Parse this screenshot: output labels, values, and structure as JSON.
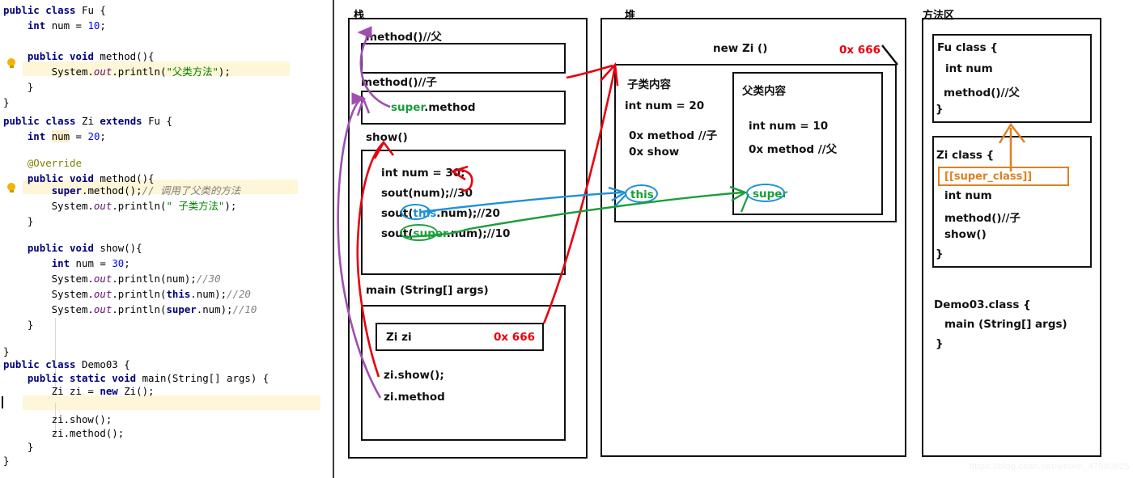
{
  "editor": {
    "lines": [
      {
        "t": "public class Fu {"
      },
      {
        "t": "    int num = 10;"
      },
      {
        "t": ""
      },
      {
        "t": "    public void method(){"
      },
      {
        "t": "        System.out.println(\"父类方法\");"
      },
      {
        "t": "    }"
      },
      {
        "t": "}"
      },
      {
        "t": ""
      },
      {
        "t": "public class Zi extends Fu {"
      },
      {
        "t": "    int num = 20;"
      },
      {
        "t": ""
      },
      {
        "t": "    @Override"
      },
      {
        "t": "    public void method(){"
      },
      {
        "t": "        super.method();// 调用了父类的方法"
      },
      {
        "t": "        System.out.println(\" 子类方法\");"
      },
      {
        "t": "    }"
      },
      {
        "t": ""
      },
      {
        "t": "    public void show(){"
      },
      {
        "t": "        int num = 30;"
      },
      {
        "t": "        System.out.println(num);//30"
      },
      {
        "t": "        System.out.println(this.num);//20"
      },
      {
        "t": "        System.out.println(super.num);//10"
      },
      {
        "t": "    }"
      },
      {
        "t": ""
      },
      {
        "t": "}"
      },
      {
        "t": "public class Demo03 {"
      },
      {
        "t": "    public static void main(String[] args) {"
      },
      {
        "t": "        Zi zi = new Zi();"
      },
      {
        "t": ""
      },
      {
        "t": "        zi.show();"
      },
      {
        "t": "        zi.method();"
      },
      {
        "t": "    }"
      },
      {
        "t": "}"
      }
    ]
  },
  "stack": {
    "zone_label": "栈",
    "frames": [
      {
        "title": "method()//父",
        "body": []
      },
      {
        "title": "method()//子",
        "body": [
          "super.method"
        ]
      },
      {
        "title": "show()",
        "body": [
          "int num = 30;",
          "sout(num);//30",
          "sout(this.num);//20",
          "sout(super.num);//10"
        ]
      },
      {
        "title": "main (String[] args)",
        "body": [
          "zi.show();",
          "zi.method"
        ]
      }
    ],
    "super_method_prefix": "super",
    "super_method_suffix": ".method",
    "show_lines": {
      "l1": "int num = 30;",
      "l2": "sout(num);//30",
      "l3_a": "sout(",
      "l3_this": "this",
      "l3_b": ".num);//20",
      "l4_a": "sout(",
      "l4_super": "super",
      "l4_b": ".num);//10"
    },
    "ref_var": "Zi zi",
    "ref_addr": "0x 666",
    "main_calls": [
      "zi.show();",
      "zi.method"
    ]
  },
  "heap": {
    "zone_label": "堆",
    "object_title": "new Zi ()",
    "object_addr": "0x 666",
    "child": {
      "title": "子类内容",
      "fields": [
        "int num = 20",
        "0x method //子",
        "0x show"
      ],
      "ref_label": "this"
    },
    "parent": {
      "title": "父类内容",
      "fields": [
        "int num = 10",
        "0x method //父"
      ],
      "ref_label": "super"
    }
  },
  "method_area": {
    "zone_label": "方法区",
    "fu_class": {
      "header": "Fu class {",
      "members": [
        "int num",
        "method()//父"
      ],
      "close": "}"
    },
    "zi_class": {
      "header": "Zi class {",
      "super_class_tag": "[[super_class]]",
      "members": [
        "int num",
        "method()//子",
        "show()"
      ],
      "close": "}"
    },
    "demo_class": {
      "header": "Demo03.class {",
      "members": [
        "main (String[] args)"
      ],
      "close": "}"
    }
  },
  "watermark": "https://blog.csdn.net/weixin_47980825",
  "colors": {
    "address_red": "#e8000d",
    "super_green": "#1a9e3b",
    "this_blue": "#1e90d8",
    "inherit_orange": "#e08020",
    "arrow_purple": "#a04fb0",
    "arrow_red": "#e8000d"
  }
}
